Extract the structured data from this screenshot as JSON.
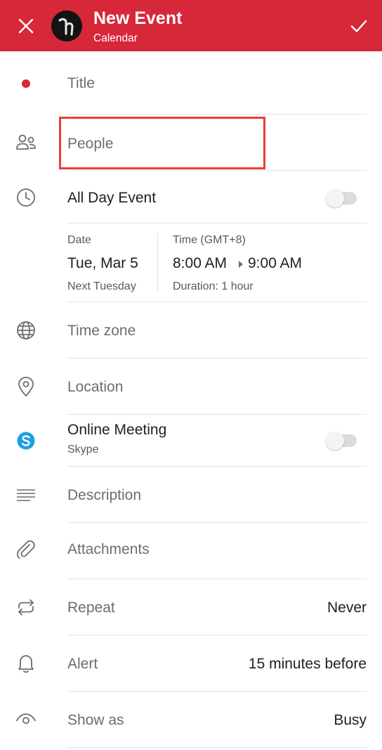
{
  "header": {
    "title": "New Event",
    "subtitle": "Calendar"
  },
  "form": {
    "title_placeholder": "Title",
    "people_placeholder": "People",
    "all_day_label": "All Day Event",
    "all_day_on": false,
    "date": {
      "date_label": "Date",
      "date_value": "Tue, Mar 5",
      "date_hint": "Next Tuesday",
      "time_label": "Time (GMT+8)",
      "start_time": "8:00 AM",
      "end_time": "9:00 AM",
      "duration": "Duration: 1 hour"
    },
    "time_zone_placeholder": "Time zone",
    "location_placeholder": "Location",
    "online_meeting_label": "Online Meeting",
    "online_meeting_provider": "Skype",
    "online_meeting_on": false,
    "description_placeholder": "Description",
    "attachments_placeholder": "Attachments",
    "repeat_label": "Repeat",
    "repeat_value": "Never",
    "alert_label": "Alert",
    "alert_value": "15 minutes before",
    "show_as_label": "Show as",
    "show_as_value": "Busy"
  },
  "colors": {
    "brand": "#d62839",
    "highlight": "#ee3b3b",
    "skype": "#1ba1e2"
  }
}
